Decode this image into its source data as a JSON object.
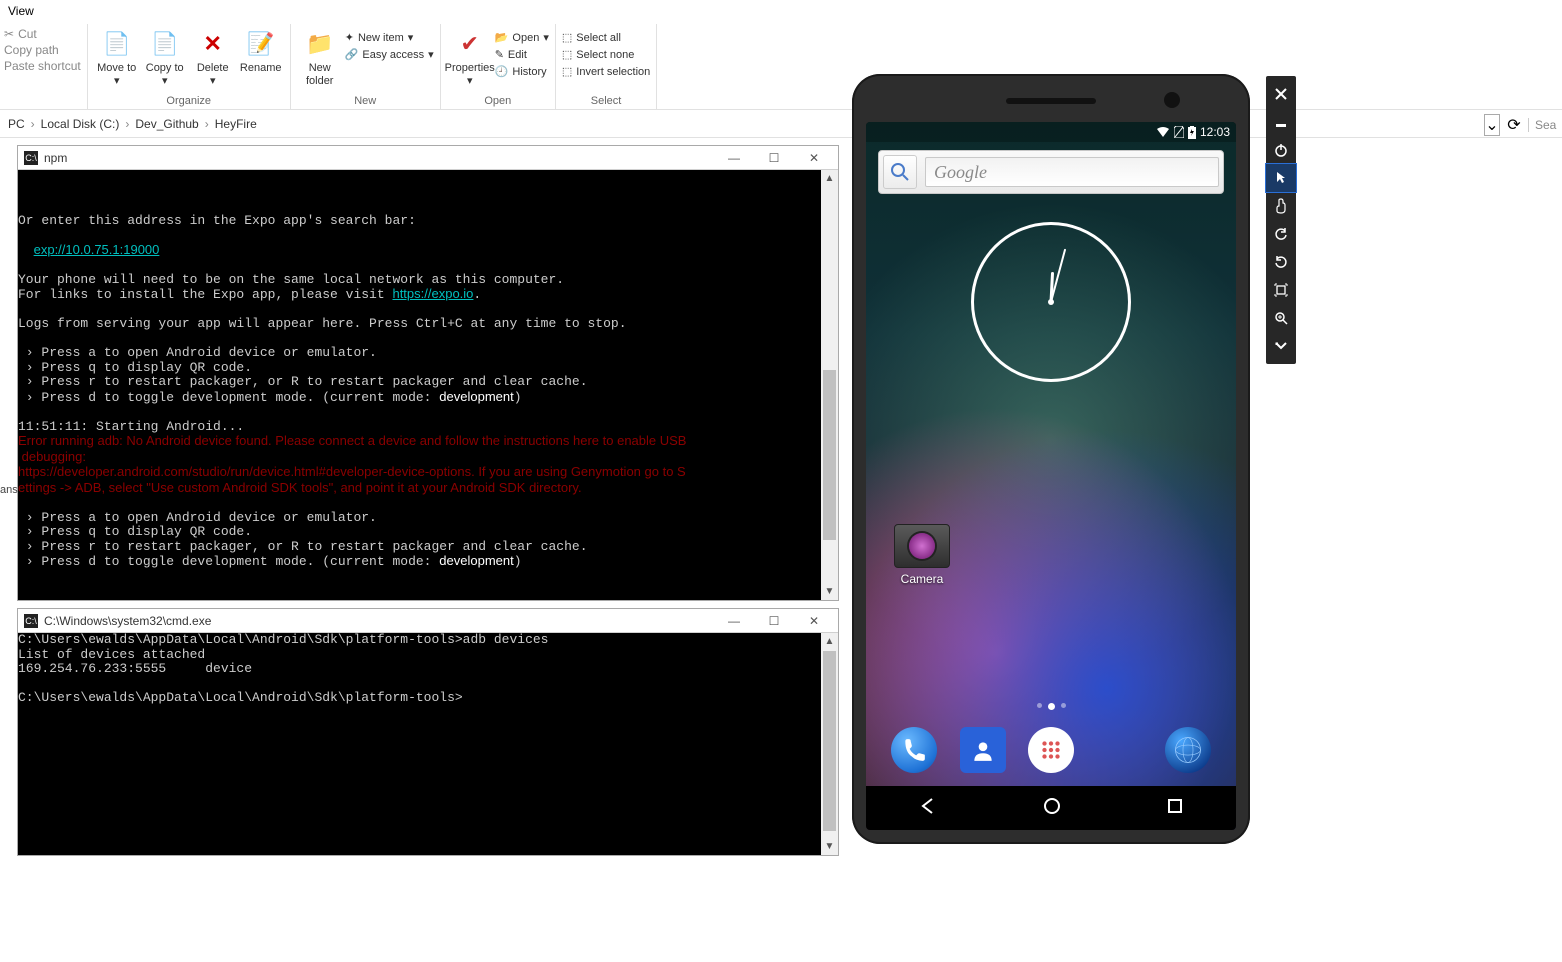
{
  "ribbon": {
    "tab": "View",
    "clipboard": {
      "cut": "Cut",
      "copy_path": "Copy path",
      "paste_shortcut": "Paste shortcut"
    },
    "organize": {
      "move_to": "Move to",
      "copy_to": "Copy to",
      "delete": "Delete",
      "rename": "Rename",
      "label": "Organize"
    },
    "new": {
      "new_folder": "New folder",
      "new_item": "New item",
      "easy_access": "Easy access",
      "label": "New"
    },
    "open": {
      "properties": "Properties",
      "open": "Open",
      "edit": "Edit",
      "history": "History",
      "label": "Open"
    },
    "select": {
      "select_all": "Select all",
      "select_none": "Select none",
      "invert": "Invert selection",
      "label": "Select"
    }
  },
  "breadcrumb": [
    "PC",
    "Local Disk (C:)",
    "Dev_Github",
    "HeyFire"
  ],
  "toolbar_right": {
    "search_placeholder": "Sea"
  },
  "terminal1": {
    "title": "npm",
    "pre_link_line": "Or enter this address in the Expo app's search bar:",
    "exp_url": "exp://10.0.75.1:19000",
    "net_line1": "Your phone will need to be on the same local network as this computer.",
    "net_line2a": "For links to install the Expo app, please visit ",
    "net_link": "https://expo.io",
    "logs_line": "Logs from serving your app will appear here. Press Ctrl+C at any time to stop.",
    "opt_a": " › Press a to open Android device or emulator.",
    "opt_q": " › Press q to display QR code.",
    "opt_r": " › Press r to restart packager, or R to restart packager and clear cache.",
    "opt_d_pre": " › Press d to toggle development mode. (current mode: ",
    "mode": "development",
    "opt_d_post": ")",
    "start_line": "11:51:11: Starting Android...",
    "err1": "Error running adb: No Android device found. Please connect a device and follow the instructions here to enable USB",
    "err2": " debugging:",
    "err3": "https://developer.android.com/studio/run/device.html#developer-device-options. If you are using Genymotion go to S",
    "err4": "ettings -> ADB, select \"Use custom Android SDK tools\", and point it at your Android SDK directory."
  },
  "terminal2": {
    "title": "C:\\Windows\\system32\\cmd.exe",
    "line1": "C:\\Users\\ewalds\\AppData\\Local\\Android\\Sdk\\platform-tools>adb devices",
    "line2": "List of devices attached",
    "line3": "169.254.76.233:5555     device",
    "line4": "",
    "line5": "C:\\Users\\ewalds\\AppData\\Local\\Android\\Sdk\\platform-tools>"
  },
  "android": {
    "time": "12:03",
    "google": "Google",
    "camera_label": "Camera"
  },
  "ans_label": "ans"
}
